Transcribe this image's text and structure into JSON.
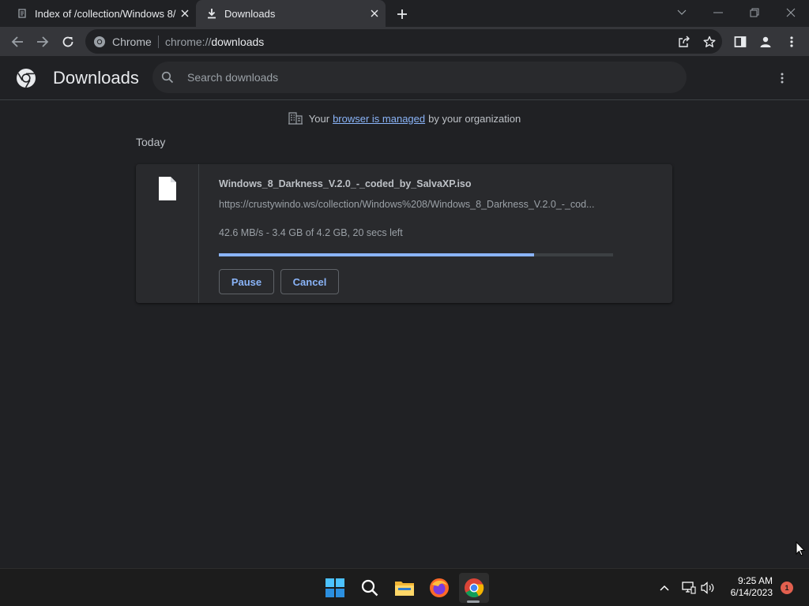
{
  "browser": {
    "tabs": [
      {
        "title": "Index of /collection/Windows 8/",
        "icon": "page-favicon-icon",
        "active": false
      },
      {
        "title": "Downloads",
        "icon": "download-icon",
        "active": true
      }
    ],
    "omnibox": {
      "label": "Chrome",
      "url_scheme": "chrome://",
      "url_host": "downloads"
    }
  },
  "page": {
    "title": "Downloads",
    "search_placeholder": "Search downloads",
    "managed_prefix": "Your",
    "managed_link": "browser is managed",
    "managed_suffix": "by your organization",
    "section": "Today"
  },
  "download": {
    "filename": "Windows_8_Darkness_V.2.0_-_coded_by_SalvaXP.iso",
    "url": "https://crustywindo.ws/collection/Windows%208/Windows_8_Darkness_V.2.0_-_cod...",
    "status": "42.6 MB/s - 3.4 GB of 4.2 GB, 20 secs left",
    "progress_percent": 80,
    "pause_label": "Pause",
    "cancel_label": "Cancel"
  },
  "taskbar": {
    "apps": [
      "windows-start-icon",
      "search-icon",
      "file-explorer-icon",
      "firefox-icon",
      "chrome-icon"
    ],
    "time": "9:25 AM",
    "date": "6/14/2023",
    "notification_count": "1"
  },
  "colors": {
    "accent": "#8ab4f8",
    "background": "#202124",
    "card": "#292a2d",
    "toolbar": "#35363a"
  }
}
